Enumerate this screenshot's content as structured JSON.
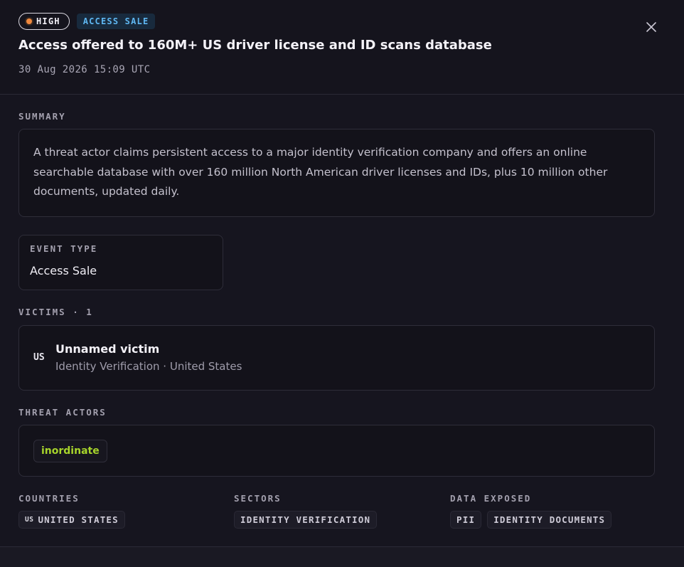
{
  "header": {
    "severity": "HIGH",
    "event_badge": "ACCESS SALE",
    "title": "Access offered to 160M+ US driver license and ID scans database",
    "timestamp": "30 Aug 2026 15:09 UTC",
    "colors": {
      "severity_dot": "#f0883e",
      "event_badge_text": "#5fb7f2",
      "event_badge_bg": "#182a3d"
    }
  },
  "summary": {
    "label": "SUMMARY",
    "text": "A threat actor claims persistent access to a major identity verification company and offers an online searchable database with over 160 million North American driver licenses and IDs, plus 10 million other documents, updated daily."
  },
  "event_type": {
    "label": "EVENT TYPE",
    "value": "Access Sale"
  },
  "victims": {
    "label": "VICTIMS · 1",
    "items": [
      {
        "country_code": "US",
        "name": "Unnamed victim",
        "meta": "Identity Verification · United States"
      }
    ]
  },
  "threat_actors": {
    "label": "THREAT ACTORS",
    "items": [
      {
        "name": "inordinate",
        "color": "#a7d42b"
      }
    ]
  },
  "countries": {
    "label": "COUNTRIES",
    "items": [
      {
        "code": "US",
        "name": "UNITED STATES"
      }
    ]
  },
  "sectors": {
    "label": "SECTORS",
    "items": [
      "IDENTITY VERIFICATION"
    ]
  },
  "data_exposed": {
    "label": "DATA EXPOSED",
    "items": [
      "PII",
      "IDENTITY DOCUMENTS"
    ]
  },
  "icons": {
    "close": "close-icon"
  }
}
